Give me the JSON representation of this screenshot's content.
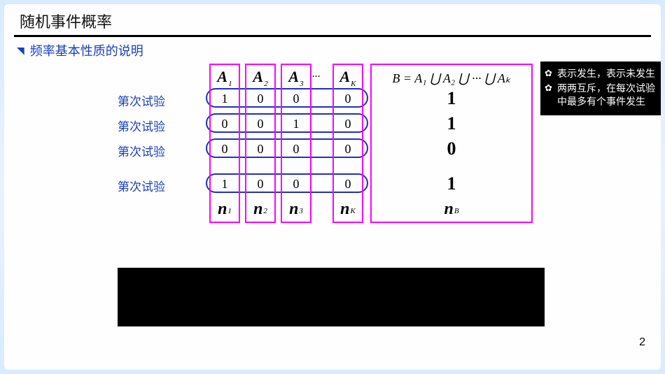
{
  "title": "随机事件概率",
  "subtitle": "频率基本性质的说明",
  "rowLabels": [
    "第次试验",
    "第次试验",
    "第次试验",
    "第次试验"
  ],
  "headers": {
    "A": "A",
    "subs": [
      "1",
      "2",
      "3",
      "K"
    ],
    "dots": "..."
  },
  "cols": {
    "c1": [
      "1",
      "0",
      "0",
      "1"
    ],
    "c2": [
      "0",
      "0",
      "0",
      "0"
    ],
    "c3": [
      "0",
      "1",
      "0",
      "0"
    ],
    "c4": [
      "0",
      "0",
      "0",
      "0"
    ]
  },
  "footers": {
    "n": "n",
    "subs": [
      "1",
      "2",
      "3",
      "K"
    ]
  },
  "bHeader": "B = A₁ ⋃ A₂ ⋃ ··· ⋃ Aₖ",
  "bValues": [
    "1",
    "1",
    "0",
    "1"
  ],
  "bFooter": {
    "n": "n",
    "sub": "B"
  },
  "notes": [
    "表示发生，表示未发生",
    "两两互斥，在每次试验中最多有个事件发生"
  ],
  "pageNum": "2"
}
